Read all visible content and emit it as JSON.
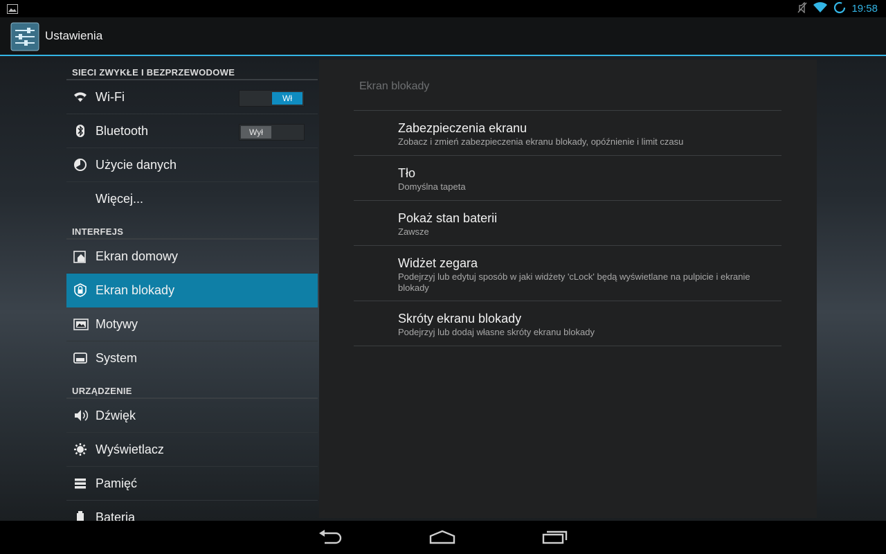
{
  "status_bar": {
    "time": "19:58",
    "icons": [
      "image-notification-icon",
      "mute-icon",
      "wifi-signal-icon",
      "sync-icon"
    ]
  },
  "action_bar": {
    "title": "Ustawienia",
    "icon": "settings-sliders-icon"
  },
  "sections": [
    {
      "header": "SIECI ZWYKŁE I BEZPRZEWODOWE",
      "items": [
        {
          "label": "Wi-Fi",
          "icon": "wifi-icon",
          "toggle": "Wł",
          "toggle_state": "on"
        },
        {
          "label": "Bluetooth",
          "icon": "bluetooth-icon",
          "toggle": "Wył",
          "toggle_state": "off"
        },
        {
          "label": "Użycie danych",
          "icon": "data-usage-icon"
        },
        {
          "label": "Więcej...",
          "icon": ""
        }
      ]
    },
    {
      "header": "INTERFEJS",
      "items": [
        {
          "label": "Ekran domowy",
          "icon": "home-screen-icon"
        },
        {
          "label": "Ekran blokady",
          "icon": "lock-screen-icon",
          "selected": true
        },
        {
          "label": "Motywy",
          "icon": "themes-icon"
        },
        {
          "label": "System",
          "icon": "system-icon"
        }
      ]
    },
    {
      "header": "URZĄDZENIE",
      "items": [
        {
          "label": "Dźwięk",
          "icon": "sound-icon"
        },
        {
          "label": "Wyświetlacz",
          "icon": "display-icon"
        },
        {
          "label": "Pamięć",
          "icon": "storage-icon"
        },
        {
          "label": "Bateria",
          "icon": "battery-icon"
        }
      ]
    }
  ],
  "detail": {
    "title": "Ekran blokady",
    "prefs": [
      {
        "title": "Zabezpieczenia ekranu",
        "summary": "Zobacz i zmień zabezpieczenia ekranu blokady, opóźnienie i limit czasu"
      },
      {
        "title": "Tło",
        "summary": "Domyślna tapeta"
      },
      {
        "title": "Pokaż stan baterii",
        "summary": "Zawsze"
      },
      {
        "title": "Widżet zegara",
        "summary": "Podejrzyj lub edytuj sposób w jaki widżety 'cLock' będą wyświetlane na pulpicie i ekranie blokady"
      },
      {
        "title": "Skróty ekranu blokady",
        "summary": "Podejrzyj lub dodaj własne skróty ekranu blokady"
      }
    ]
  },
  "nav_bar": {
    "buttons": [
      "back-icon",
      "home-icon",
      "recent-apps-icon"
    ]
  },
  "colors": {
    "accent": "#33b5e5",
    "selected": "#0f7fa6",
    "toggle_on": "#0f8cc0"
  }
}
